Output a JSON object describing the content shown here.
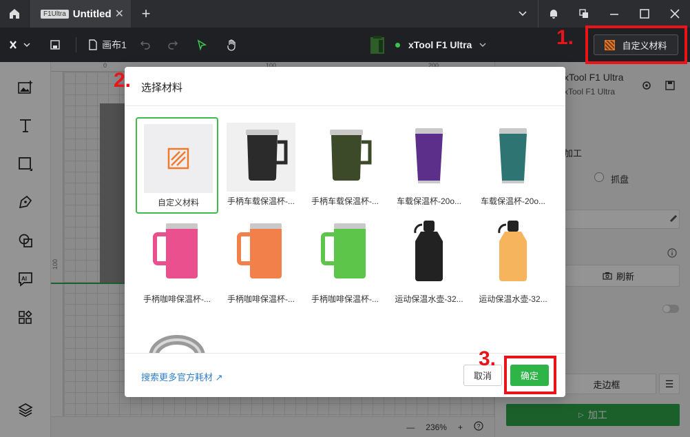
{
  "titlebar": {
    "tab_badge": "F1Ultra",
    "tab_title": "Untitled",
    "close_glyph": "✕",
    "add_tab_glyph": "+"
  },
  "toolbar": {
    "canvas_name": "画布1",
    "device_name": "xTool F1 Ultra",
    "custom_material_label": "自定义材料"
  },
  "right_panel": {
    "device_title": "xTool F1 Ultra",
    "device_sub": "xTool F1 Ultra",
    "process_label": "加工",
    "grab_label": "抓盘",
    "refresh_label": "刷新",
    "frame_label": "走边框",
    "process_button": "加工"
  },
  "canvas": {
    "ruler_marks": [
      "0",
      "100",
      "200"
    ],
    "ruler_left_mark": "100",
    "zoom": "236%"
  },
  "modal": {
    "title": "选择材料",
    "materials": [
      {
        "label": "自定义材料",
        "kind": "custom",
        "selected": true
      },
      {
        "label": "手柄车载保温杯-...",
        "kind": "mug",
        "color": "#2b2b2b"
      },
      {
        "label": "手柄车载保温杯-...",
        "kind": "mug",
        "color": "#3c4a2a"
      },
      {
        "label": "车载保温杯-20o...",
        "kind": "tumbler",
        "color": "#5b2f8a"
      },
      {
        "label": "车载保温杯-20o...",
        "kind": "tumbler",
        "color": "#2e7473"
      },
      {
        "label": "手柄咖啡保温杯-...",
        "kind": "coffee",
        "color": "#ea4f8e"
      },
      {
        "label": "手柄咖啡保温杯-...",
        "kind": "coffee",
        "color": "#f2804a"
      },
      {
        "label": "手柄咖啡保温杯-...",
        "kind": "coffee",
        "color": "#5cc54a"
      },
      {
        "label": "运动保温水壶-32...",
        "kind": "bottle",
        "color": "#222222"
      },
      {
        "label": "运动保温水壶-32...",
        "kind": "bottle",
        "color": "#f6b45c"
      },
      {
        "label": "",
        "kind": "ring",
        "color": "#9a9a9a"
      }
    ],
    "more_link": "搜索更多官方耗材",
    "link_arrow": "↗",
    "cancel": "取消",
    "ok": "确定"
  },
  "annotations": [
    "1.",
    "2.",
    "3."
  ],
  "colors": {
    "accent": "#2fb447",
    "annotation": "#e8141a",
    "link": "#2f7fd1"
  }
}
